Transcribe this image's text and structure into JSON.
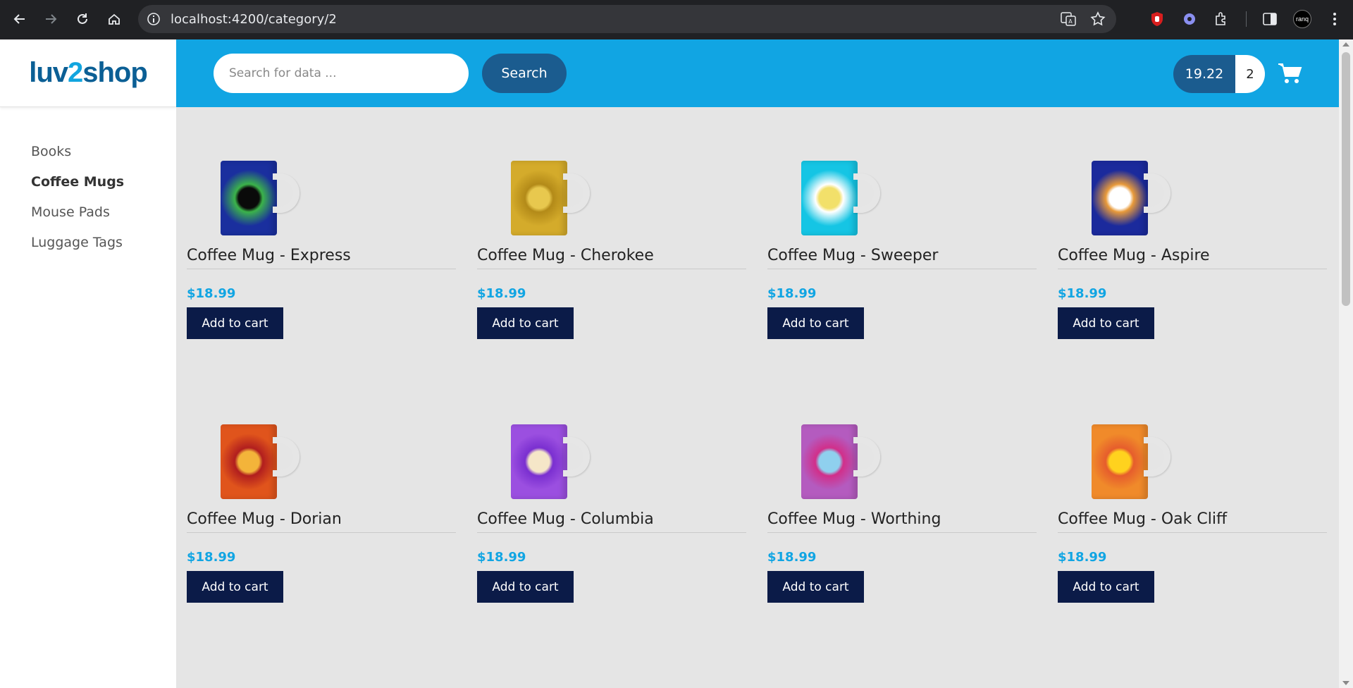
{
  "browser": {
    "url": "localhost:4200/category/2",
    "profile_label": "ranq"
  },
  "logo": {
    "text_a": "luv",
    "text_b": "2",
    "text_c": "shop"
  },
  "sidebar": {
    "items": [
      {
        "label": "Books",
        "active": false
      },
      {
        "label": "Coffee Mugs",
        "active": true
      },
      {
        "label": "Mouse Pads",
        "active": false
      },
      {
        "label": "Luggage Tags",
        "active": false
      }
    ]
  },
  "search": {
    "placeholder": "Search for data ...",
    "button_label": "Search"
  },
  "cart": {
    "total": "19.22",
    "quantity": "2"
  },
  "products": [
    {
      "name": "Coffee Mug - Express",
      "price": "$18.99",
      "button": "Add to cart",
      "colors": [
        "#1a2f9e",
        "#0a0a0a",
        "#3bb34a"
      ]
    },
    {
      "name": "Coffee Mug - Cherokee",
      "price": "$18.99",
      "button": "Add to cart",
      "colors": [
        "#d4ab2b",
        "#e8c84e",
        "#b38a18"
      ]
    },
    {
      "name": "Coffee Mug - Sweeper",
      "price": "$18.99",
      "button": "Add to cart",
      "colors": [
        "#15c5e4",
        "#f2e06a",
        "#ffffff"
      ]
    },
    {
      "name": "Coffee Mug - Aspire",
      "price": "$18.99",
      "button": "Add to cart",
      "colors": [
        "#1b2a9c",
        "#ffffff",
        "#e89a3a"
      ]
    },
    {
      "name": "Coffee Mug - Dorian",
      "price": "$18.99",
      "button": "Add to cart",
      "colors": [
        "#e0541c",
        "#f3b43a",
        "#b11e1e"
      ]
    },
    {
      "name": "Coffee Mug - Columbia",
      "price": "$18.99",
      "button": "Add to cart",
      "colors": [
        "#9b4fe0",
        "#f5e6c8",
        "#7a2fd0"
      ]
    },
    {
      "name": "Coffee Mug - Worthing",
      "price": "$18.99",
      "button": "Add to cart",
      "colors": [
        "#b45bbf",
        "#8fd0ee",
        "#d12f8a"
      ]
    },
    {
      "name": "Coffee Mug - Oak Cliff",
      "price": "$18.99",
      "button": "Add to cart",
      "colors": [
        "#f08a2a",
        "#ffd21e",
        "#e65d2c"
      ]
    }
  ],
  "colors": {
    "topbar": "#11a5e3",
    "accent_dark": "#1b5c8f",
    "button_dark": "#0b1b48",
    "price": "#11a5e3"
  }
}
